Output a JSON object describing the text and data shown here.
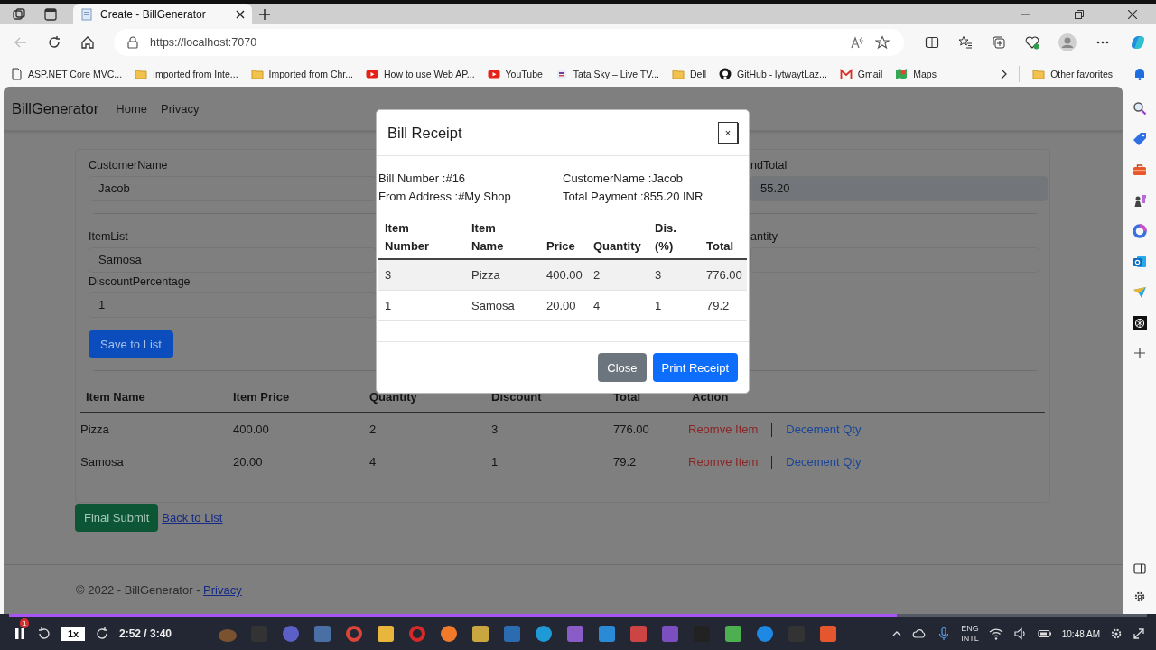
{
  "browser": {
    "tabs": [
      {
        "title": "Create - BillGenerator",
        "selected": true
      }
    ],
    "address": "https://localhost:7070",
    "bookmarks": [
      {
        "label": "ASP.NET Core MVC...",
        "kind": "page"
      },
      {
        "label": "Imported from Inte...",
        "kind": "folder"
      },
      {
        "label": "Imported from Chr...",
        "kind": "folder"
      },
      {
        "label": "How to use Web AP...",
        "kind": "video"
      },
      {
        "label": "YouTube",
        "kind": "video"
      },
      {
        "label": "Tata Sky – Live TV...",
        "kind": "tv"
      },
      {
        "label": "Dell",
        "kind": "folder"
      },
      {
        "label": "GitHub - lytwaytLaz...",
        "kind": "github"
      },
      {
        "label": "Gmail",
        "kind": "mail"
      },
      {
        "label": "Maps",
        "kind": "map"
      }
    ],
    "other_favorites": "Other favorites"
  },
  "navbar": {
    "brand": "BillGenerator",
    "links": [
      "Home",
      "Privacy"
    ]
  },
  "form": {
    "customer": {
      "label": "CustomerName",
      "value": "Jacob"
    },
    "grand_total": {
      "label": "ndTotal",
      "value": "55.20"
    },
    "item_list": {
      "label": "ItemList",
      "value": "Samosa"
    },
    "quantity": {
      "label": "antity"
    },
    "discount": {
      "label": "DiscountPercentage",
      "value": "1"
    },
    "save_button": "Save to List"
  },
  "items_table": {
    "columns": [
      "Item Name",
      "Item Price",
      "Quantity",
      "Discount",
      "Total",
      "Action"
    ],
    "rows": [
      {
        "cells": [
          "Pizza",
          "400.00",
          "2",
          "3",
          "776.00"
        ],
        "actions": [
          "Reomve Item",
          "Decement Qty"
        ],
        "focused": true
      },
      {
        "cells": [
          "Samosa",
          "20.00",
          "4",
          "1",
          "79.2"
        ],
        "actions": [
          "Reomve Item",
          "Decement Qty"
        ],
        "focused": false
      }
    ]
  },
  "final_submit": "Final Submit",
  "back_link": "Back to List",
  "footer": {
    "text": "© 2022 - BillGenerator - ",
    "link": "Privacy"
  },
  "modal": {
    "title": "Bill Receipt",
    "close_glyph": "×",
    "info": [
      "Bill Number :#16",
      "CustomerName :Jacob",
      "From Address :#My Shop",
      "Total Payment :855.20 INR"
    ],
    "columns": [
      "Item Number",
      "Item Name",
      "Price",
      "Quantity",
      "Dis. (%)",
      "Total"
    ],
    "rows": [
      [
        "3",
        "Pizza",
        "400.00",
        "2",
        "3",
        "776.00"
      ],
      [
        "1",
        "Samosa",
        "20.00",
        "4",
        "1",
        "79.2"
      ]
    ],
    "buttons": [
      {
        "label": "Close",
        "kind": "secondary"
      },
      {
        "label": "Print Receipt",
        "kind": "primary"
      }
    ]
  },
  "video_player": {
    "badge": "1",
    "speed": "1x",
    "time": "2:52 / 3:40",
    "level": 0.78
  },
  "taskbar": {
    "language": [
      "ENG",
      "INTL"
    ],
    "clock": "10:48 AM"
  }
}
